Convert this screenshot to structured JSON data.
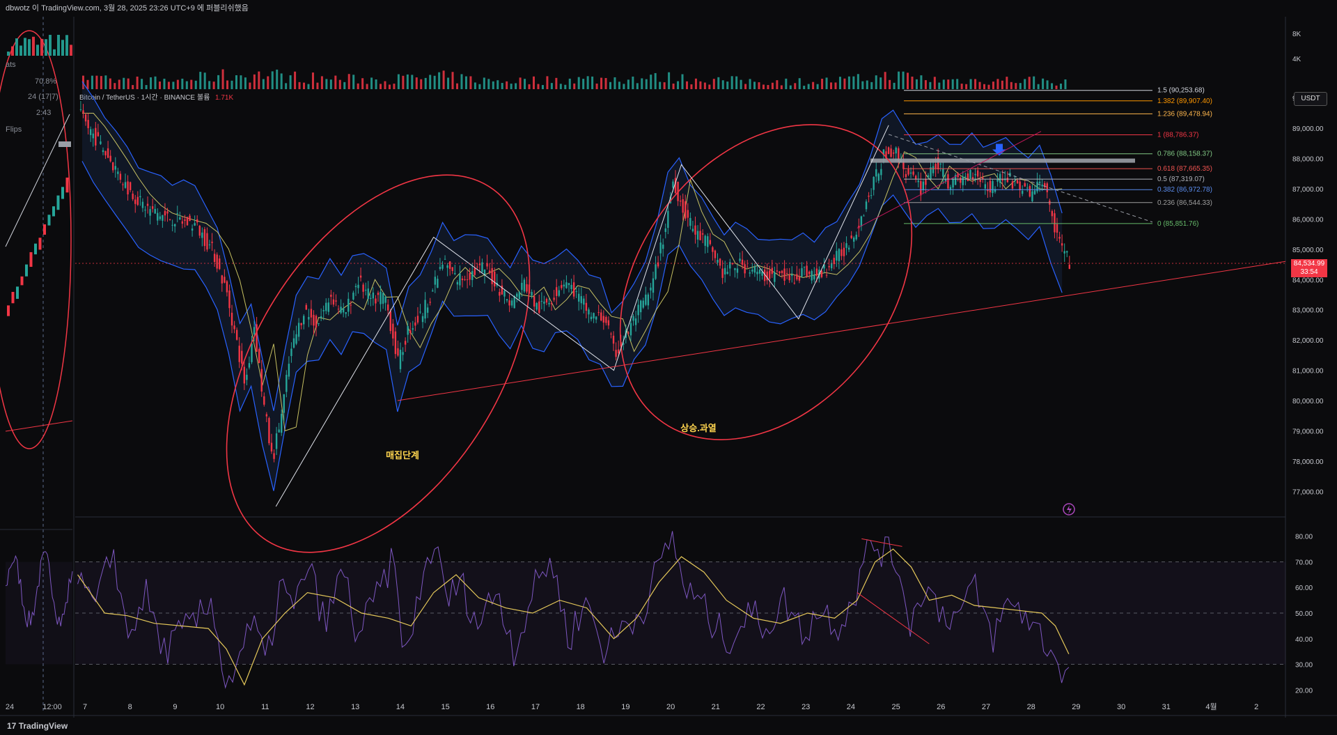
{
  "header": {
    "text": "dbwotz 이 TradingView.com, 3월 28, 2025 23:26 UTC+9 에 퍼블리쉬했음"
  },
  "footer": {
    "brand": "TradingView",
    "brand_mark": "17"
  },
  "legend": {
    "symbol": "Bitcoin / TetherUS · 1시간 · BINANCE",
    "volume_label": "볼륨",
    "volume_value": "1.71K"
  },
  "currency_button": "USDT",
  "current_price": {
    "value": "84,534.99",
    "countdown": "33:54"
  },
  "left_panel": {
    "labels": [
      "ats",
      "70.8%",
      "24 (17|7)",
      "2:43",
      "Flips"
    ],
    "time_labels": [
      "24",
      "12:00"
    ]
  },
  "annotations": {
    "accumulation": "매집단계",
    "overheat": "상승.과열"
  },
  "colors": {
    "up": "#26a69a",
    "down": "#f23645",
    "band": "#2962ff",
    "basis": "#d9d36a",
    "rsi": "#7e57c2",
    "rsi_ma": "#e5c85a",
    "ellipse": "#f23645"
  },
  "chart_data": [
    {
      "type": "line",
      "title": "Bitcoin / TetherUS · 1시간 · BINANCE",
      "x_ticks": [
        "7",
        "8",
        "9",
        "10",
        "11",
        "12",
        "13",
        "14",
        "15",
        "16",
        "17",
        "18",
        "19",
        "20",
        "21",
        "22",
        "23",
        "24",
        "25",
        "26",
        "27",
        "28",
        "29",
        "30",
        "31",
        "4월",
        "2"
      ],
      "y_ticks": [
        77000,
        78000,
        79000,
        80000,
        81000,
        82000,
        83000,
        84000,
        85000,
        86000,
        87000,
        88000,
        89000,
        90000
      ],
      "y_tick_labels": [
        "77,000.00",
        "78,000.00",
        "79,000.00",
        "80,000.00",
        "81,000.00",
        "82,000.00",
        "83,000.00",
        "84,000.00",
        "85,000.00",
        "86,000.00",
        "87,000.00",
        "88,000.00",
        "89,000.00",
        "90,000.00"
      ],
      "ylim": [
        76200,
        90800
      ],
      "series": [
        {
          "x": [
            6.9,
            7.5,
            8.0,
            8.3,
            8.6,
            9.0,
            9.5,
            9.9,
            10.2,
            10.4,
            10.6,
            10.8,
            11.0,
            11.2,
            11.4,
            11.6,
            11.9,
            12.2,
            12.5,
            12.8,
            13.1,
            13.4,
            13.7,
            14.0,
            14.2,
            14.5,
            14.8,
            15.0,
            15.3,
            15.6,
            15.9,
            16.2,
            16.5,
            16.8,
            17.1,
            17.4,
            17.7,
            18.0,
            18.3,
            18.6,
            18.8,
            19.0,
            19.3,
            19.6,
            19.9,
            20.1,
            20.3,
            20.6,
            20.9,
            21.2,
            21.5,
            21.8,
            22.1,
            22.4,
            22.7,
            23.0,
            23.3,
            23.6,
            23.9,
            24.2,
            24.5,
            24.8,
            25.0,
            25.3,
            25.6,
            25.9,
            26.2,
            26.5,
            26.8,
            27.1,
            27.4,
            27.7,
            28.0,
            28.3,
            28.6,
            28.8,
            28.9
          ],
          "values": [
            89500,
            88200,
            87000,
            86500,
            86200,
            86000,
            85800,
            84900,
            83500,
            82000,
            80500,
            82500,
            80000,
            78000,
            79500,
            81500,
            83000,
            82500,
            83500,
            82800,
            84000,
            83300,
            83500,
            81200,
            82300,
            82800,
            83800,
            84600,
            84000,
            84200,
            84400,
            83800,
            83200,
            83900,
            83000,
            83400,
            84000,
            83400,
            82800,
            82700,
            81500,
            82000,
            82900,
            83600,
            85500,
            87300,
            86400,
            85500,
            85200,
            84200,
            84500,
            84400,
            84100,
            84200,
            84000,
            84300,
            84100,
            84500,
            85000,
            85800,
            87000,
            88200,
            88300,
            87500,
            87000,
            87900,
            87200,
            87300,
            87600,
            87000,
            87400,
            87200,
            86800,
            87300,
            85500,
            84800,
            84535
          ],
          "name": ""
        },
        {
          "name": "",
          "type": "bar",
          "x": [
            7,
            8,
            9,
            10,
            11,
            12,
            13,
            14,
            15,
            16,
            17,
            18,
            19,
            20,
            21,
            22,
            23,
            24,
            25,
            26,
            27,
            28,
            28.9
          ],
          "values": [
            2.5,
            2.3,
            2.2,
            3.5,
            3.8,
            3.0,
            2.6,
            2.7,
            3.2,
            2.2,
            2.3,
            2.6,
            2.8,
            3.0,
            2.4,
            2.1,
            2.0,
            2.4,
            3.6,
            2.4,
            2.3,
            2.5,
            1.71
          ],
          "y_ticks": [
            4000,
            8000
          ],
          "y_tick_labels": [
            "4K",
            "8K"
          ]
        }
      ],
      "fib_levels": [
        {
          "label": "1.5 (90,253.68)",
          "value": 90253.68,
          "color": "#d1d4dc"
        },
        {
          "label": "1.382 (89,907.40)",
          "value": 89907.4,
          "color": "#ff9800"
        },
        {
          "label": "1.236 (89,478.94)",
          "value": 89478.94,
          "color": "#ffb74d"
        },
        {
          "label": "1 (88,786.37)",
          "value": 88786.37,
          "color": "#f23645"
        },
        {
          "label": "0.786 (88,158.37)",
          "value": 88158.37,
          "color": "#81c784"
        },
        {
          "label": "0.618 (87,665.35)",
          "value": 87665.35,
          "color": "#ef5350"
        },
        {
          "label": "0.5 (87,319.07)",
          "value": 87319.07,
          "color": "#b0b3ba"
        },
        {
          "label": "0.382 (86,972.78)",
          "value": 86972.78,
          "color": "#5b8def"
        },
        {
          "label": "0.236 (86,544.33)",
          "value": 86544.33,
          "color": "#9e9e9e"
        },
        {
          "label": "0 (85,851.76)",
          "value": 85851.76,
          "color": "#66bb6a"
        }
      ]
    },
    {
      "type": "line",
      "title": "",
      "y_ticks": [
        20,
        30,
        40,
        50,
        60,
        70,
        80
      ],
      "y_tick_labels": [
        "20.00",
        "30.00",
        "40.00",
        "50.00",
        "60.00",
        "70.00",
        "80.00"
      ],
      "ylim": [
        16,
        84
      ],
      "bands": [
        30,
        50,
        70
      ],
      "series": [
        {
          "name": "",
          "x": [
            6.9,
            7.3,
            7.7,
            8.0,
            8.4,
            8.8,
            9.2,
            9.6,
            9.9,
            10.2,
            10.5,
            10.8,
            11.1,
            11.4,
            11.7,
            12.0,
            12.4,
            12.8,
            13.1,
            13.5,
            13.9,
            14.2,
            14.5,
            14.8,
            15.1,
            15.4,
            15.8,
            16.2,
            16.6,
            17.0,
            17.4,
            17.8,
            18.2,
            18.6,
            19.0,
            19.4,
            19.8,
            20.1,
            20.4,
            20.7,
            21.0,
            21.4,
            21.8,
            22.2,
            22.6,
            23.0,
            23.4,
            23.8,
            24.2,
            24.5,
            24.8,
            25.1,
            25.4,
            25.7,
            26.0,
            26.4,
            26.8,
            27.2,
            27.6,
            28.0,
            28.4,
            28.7,
            28.9
          ],
          "values": [
            62,
            52,
            75,
            40,
            58,
            35,
            42,
            48,
            55,
            20,
            35,
            45,
            30,
            62,
            50,
            70,
            45,
            68,
            40,
            55,
            70,
            30,
            60,
            78,
            55,
            62,
            45,
            60,
            35,
            58,
            72,
            40,
            55,
            35,
            45,
            50,
            68,
            80,
            58,
            55,
            45,
            40,
            50,
            45,
            55,
            42,
            52,
            45,
            60,
            78,
            74,
            70,
            45,
            62,
            52,
            48,
            60,
            40,
            55,
            48,
            38,
            30,
            25
          ]
        },
        {
          "name": "",
          "x": [
            6.9,
            7.5,
            8.0,
            8.6,
            9.2,
            9.8,
            10.2,
            10.6,
            11.0,
            11.5,
            12.0,
            12.6,
            13.2,
            13.8,
            14.3,
            14.8,
            15.3,
            15.8,
            16.4,
            17.0,
            17.6,
            18.2,
            18.8,
            19.3,
            19.8,
            20.3,
            20.8,
            21.3,
            21.9,
            22.5,
            23.1,
            23.7,
            24.2,
            24.6,
            25.0,
            25.4,
            25.8,
            26.3,
            26.8,
            27.3,
            27.8,
            28.3,
            28.6,
            28.9
          ],
          "values": [
            65,
            50,
            49,
            46,
            45,
            44,
            36,
            22,
            40,
            50,
            58,
            56,
            50,
            48,
            45,
            58,
            65,
            56,
            52,
            50,
            55,
            52,
            40,
            48,
            62,
            72,
            66,
            55,
            48,
            46,
            50,
            48,
            55,
            70,
            75,
            68,
            55,
            57,
            53,
            52,
            51,
            50,
            45,
            34
          ]
        }
      ]
    }
  ]
}
